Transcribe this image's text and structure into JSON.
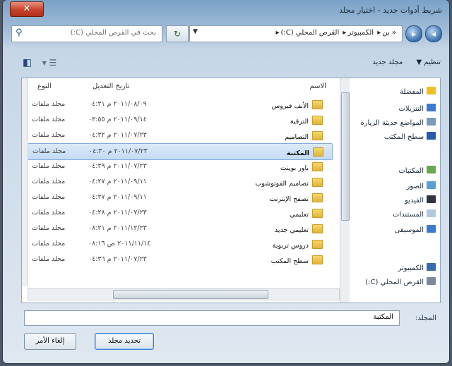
{
  "window": {
    "title": "شريط أدوات جديد - اختيار مجلد",
    "close_label": "✕"
  },
  "address_bar": {
    "crumbs": [
      "« بن",
      "الكمبيوتر",
      "القرص المحلي (C:)"
    ],
    "dropdown": "▼"
  },
  "search": {
    "placeholder": "بحث في القرص المحلي (C:)"
  },
  "toolbar": {
    "organize": "تنظيم ▼",
    "new_folder": "مجلد جديد"
  },
  "nav": {
    "items": [
      {
        "label": "المفضلة",
        "color": "#f0c020"
      },
      {
        "label": "التنزيلات",
        "color": "#3a7bd0"
      },
      {
        "label": "المواضع حديثة الزيارة",
        "color": "#7a9ab8"
      },
      {
        "label": "سطح المكتب",
        "color": "#2a5ab0"
      },
      {
        "label": "المكتبات",
        "color": "#6aa84f"
      },
      {
        "label": "الصور",
        "color": "#5aa0d8"
      },
      {
        "label": "الفيديو",
        "color": "#334"
      },
      {
        "label": "المستندات",
        "color": "#b0c8e0"
      },
      {
        "label": "الموسيقى",
        "color": "#3a7bd0"
      },
      {
        "label": "الكمبيوتر",
        "color": "#3a6ab0"
      },
      {
        "label": "القرص المحلي (C:)",
        "color": "#7a8a9a"
      }
    ]
  },
  "columns": {
    "name": "الاسم",
    "date": "تاريخ التعديل",
    "type": "النوع"
  },
  "files": [
    {
      "name": "الأنف فيروس",
      "date": "٢٠١١/٠٨/٠٩ م ٠٤:٣١",
      "type": "مجلد ملفات"
    },
    {
      "name": "الترقية",
      "date": "٢٠١١/٠٩/١٤ م ٠٣:٥٥",
      "type": "مجلد ملفات"
    },
    {
      "name": "التصاميم",
      "date": "٢٠١١/٠٧/٢٣ م ٠٤:٣٢",
      "type": "مجلد ملفات"
    },
    {
      "name": "المكتبة",
      "date": "٢٠١١/٠٧/٢٣ م ٠٤:٣٠",
      "type": "مجلد ملفات"
    },
    {
      "name": "باور بوينت",
      "date": "٢٠١١/٠٧/٢٣ م ٠٤:٢٩",
      "type": "مجلد ملفات"
    },
    {
      "name": "تصاميم الفوتوشوب",
      "date": "٢٠١١/٠٩/١١ م ٠٤:٢٧",
      "type": "مجلد ملفات"
    },
    {
      "name": "تصفح الإنترنت",
      "date": "٢٠١١/٠٩/١١ م ٠٤:٢٧",
      "type": "مجلد ملفات"
    },
    {
      "name": "تعليمي",
      "date": "٢٠١١/٠٧/٢٣ م ٠٤:٢٨",
      "type": "مجلد ملفات"
    },
    {
      "name": "تعليمي جديد",
      "date": "٢٠١١/١٢/٢٣ م ٠٨:٢١",
      "type": "مجلد ملفات"
    },
    {
      "name": "دروس تربوية",
      "date": "٢٠١١/١١/١٤ ص ٠٨:١٦",
      "type": "مجلد ملفات"
    },
    {
      "name": "سطح المكتب",
      "date": "٢٠١١/٠٧/٢٣ م ٠٤:٣٦",
      "type": "مجلد ملفات"
    }
  ],
  "selected_index": 3,
  "filename": {
    "label": "المجلد:",
    "value": "المكتبة"
  },
  "buttons": {
    "select": "تحديد مجلد",
    "cancel": "إلغاء الأمر"
  }
}
